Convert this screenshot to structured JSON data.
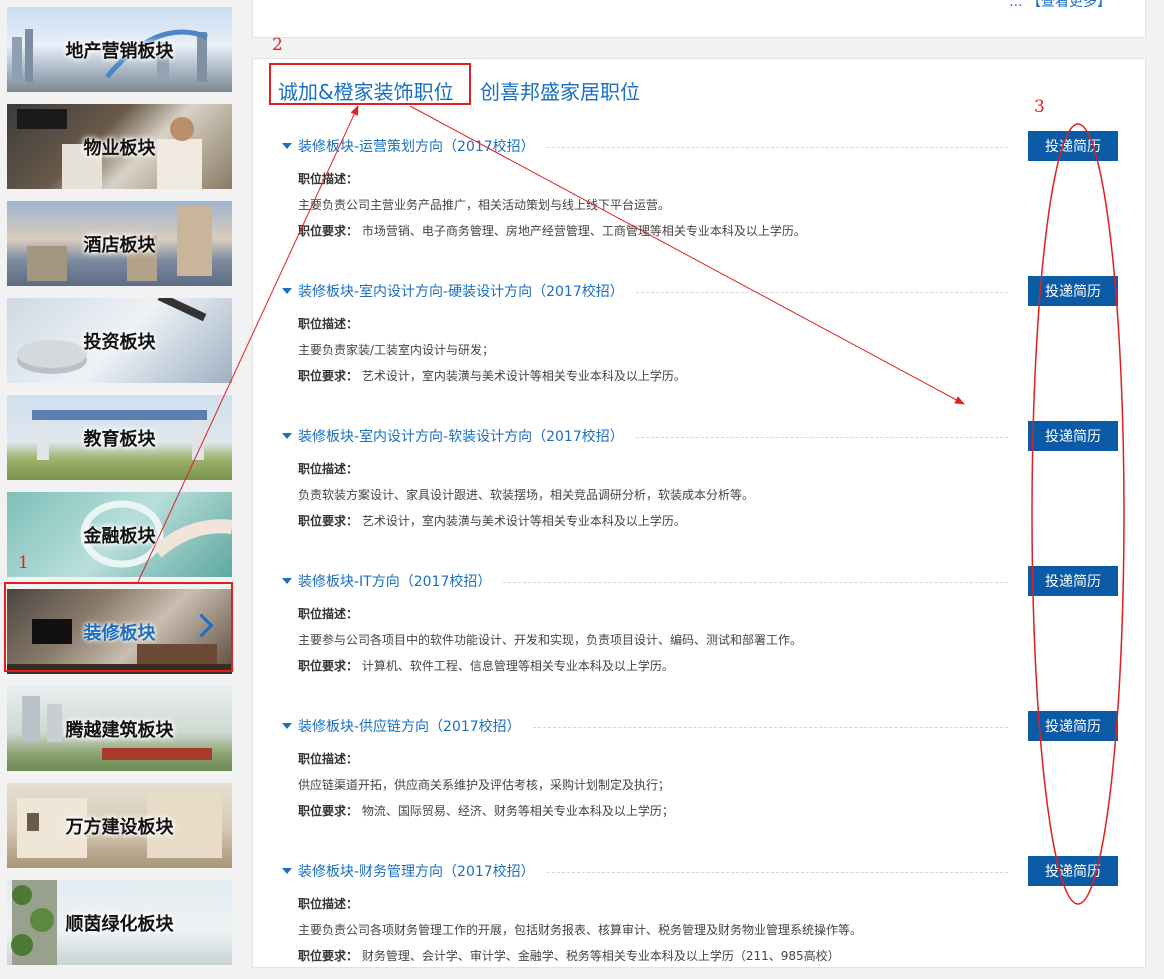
{
  "sidebar": {
    "items": [
      {
        "label": "地产营销板块",
        "scene": "skyline"
      },
      {
        "label": "物业板块",
        "scene": "staff"
      },
      {
        "label": "酒店板块",
        "scene": "cityscape"
      },
      {
        "label": "投资板块",
        "scene": "coins"
      },
      {
        "label": "教育板块",
        "scene": "school"
      },
      {
        "label": "金融板块",
        "scene": "finance"
      },
      {
        "label": "装修板块",
        "scene": "interior",
        "active": true
      },
      {
        "label": "腾越建筑板块",
        "scene": "highrise"
      },
      {
        "label": "万方建设板块",
        "scene": "villa"
      },
      {
        "label": "顺茵绿化板块",
        "scene": "greenery"
      }
    ]
  },
  "top_panel": {
    "more_text": "... 【查看更多】"
  },
  "tabs": [
    {
      "label": "诚加&橙家装饰职位",
      "active": true
    },
    {
      "label": "创喜邦盛家居职位",
      "active": false
    }
  ],
  "apply_label": "投递简历",
  "desc_label": "职位描述：",
  "req_label": "职位要求：",
  "jobs": [
    {
      "title": "装修板块-运营策划方向（2017校招）",
      "desc": "主要负责公司主营业务产品推广，相关活动策划与线上线下平台运营。",
      "req": "市场营销、电子商务管理、房地产经营管理、工商管理等相关专业本科及以上学历。"
    },
    {
      "title": "装修板块-室内设计方向-硬装设计方向（2017校招）",
      "desc": "主要负责家装/工装室内设计与研发；",
      "req": "艺术设计，室内装潢与美术设计等相关专业本科及以上学历。"
    },
    {
      "title": "装修板块-室内设计方向-软装设计方向（2017校招）",
      "desc": "负责软装方案设计、家具设计跟进、软装摆场，相关竞品调研分析，软装成本分析等。",
      "req": "艺术设计，室内装潢与美术设计等相关专业本科及以上学历。"
    },
    {
      "title": "装修板块-IT方向（2017校招）",
      "desc": "主要参与公司各项目中的软件功能设计、开发和实现，负责项目设计、编码、测试和部署工作。",
      "req": "计算机、软件工程、信息管理等相关专业本科及以上学历。"
    },
    {
      "title": "装修板块-供应链方向（2017校招）",
      "desc": "供应链渠道开拓，供应商关系维护及评估考核，采购计划制定及执行；",
      "req": "物流、国际贸易、经济、财务等相关专业本科及以上学历；"
    },
    {
      "title": "装修板块-财务管理方向（2017校招）",
      "desc": "主要负责公司各项财务管理工作的开展，包括财务报表、核算审计、税务管理及财务物业管理系统操作等。",
      "req": "财务管理、会计学、审计学、金融学、税务等相关专业本科及以上学历（211、985高校）"
    }
  ],
  "annotations": [
    "1",
    "2",
    "3"
  ],
  "colors": {
    "link": "#1a6fc0",
    "button": "#0b5aa6",
    "annotation": "#e02020"
  }
}
